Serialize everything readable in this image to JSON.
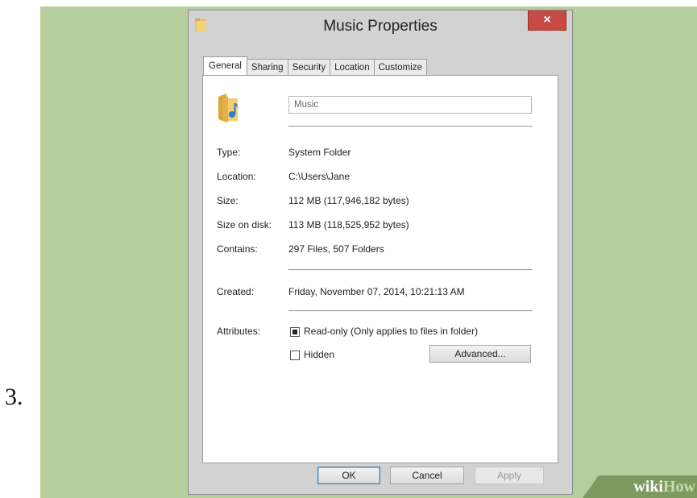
{
  "step_number": "3.",
  "window": {
    "title": "Music Properties",
    "close_label": "×"
  },
  "tabs": [
    "General",
    "Sharing",
    "Security",
    "Location",
    "Customize"
  ],
  "general": {
    "name_value": "Music",
    "properties": [
      {
        "label": "Type:",
        "value": "System Folder"
      },
      {
        "label": "Location:",
        "value": "C:\\Users\\Jane"
      },
      {
        "label": "Size:",
        "value": "112 MB (117,946,182 bytes)"
      },
      {
        "label": "Size on disk:",
        "value": "113 MB (118,525,952 bytes)"
      },
      {
        "label": "Contains:",
        "value": "297 Files, 507 Folders"
      }
    ],
    "created_label": "Created:",
    "created_value": "Friday, November 07, 2014, 10:21:13 AM",
    "attributes_label": "Attributes:",
    "readonly_label": "Read-only (Only applies to files in folder)",
    "readonly_state": "indeterminate",
    "hidden_label": "Hidden",
    "hidden_checked": false,
    "advanced_button": "Advanced..."
  },
  "footer": {
    "ok": "OK",
    "cancel": "Cancel",
    "apply": "Apply"
  },
  "watermark": {
    "part1": "wiki",
    "part2": "How"
  },
  "colors": {
    "background": "#b5ce9c",
    "close_button": "#c74a44",
    "folder": "#e8c060",
    "music_note": "#2f7fd0"
  }
}
